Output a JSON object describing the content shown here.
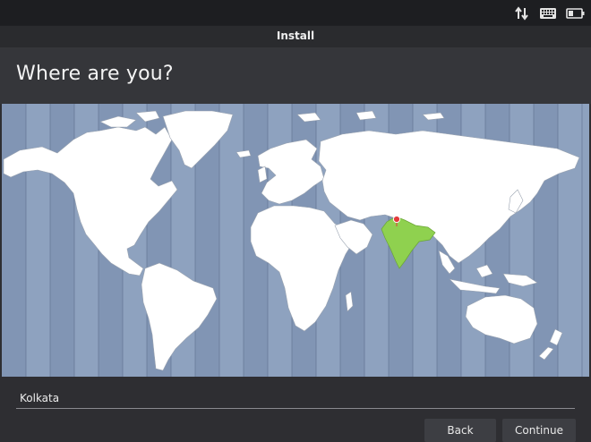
{
  "top_panel": {
    "icons": [
      "network-arrows-icon",
      "keyboard-icon",
      "battery-icon"
    ]
  },
  "window": {
    "title": "Install"
  },
  "page": {
    "title": "Where are you?"
  },
  "map": {
    "selected_country": "India",
    "ocean_color": "#8ea2bf",
    "land_color": "#ffffff",
    "highlight_color": "#8fd14f",
    "marker_color": "#e23b3b"
  },
  "timezone": {
    "value": "Kolkata"
  },
  "buttons": {
    "back": "Back",
    "continue": "Continue"
  }
}
